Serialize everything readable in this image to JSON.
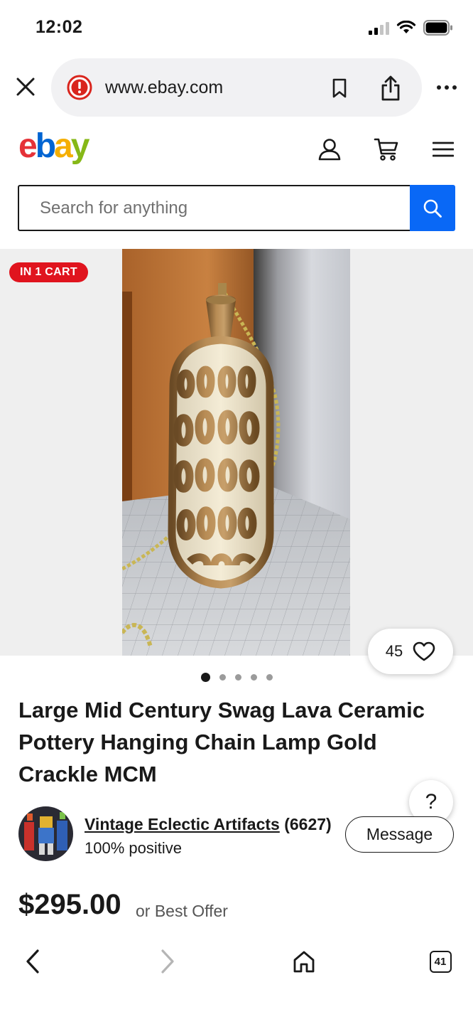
{
  "status_bar": {
    "time": "12:02"
  },
  "browser": {
    "url": "www.ebay.com"
  },
  "site": {
    "logo_letters": [
      "e",
      "b",
      "a",
      "y"
    ],
    "logo_colors": [
      "#e53238",
      "#0064d2",
      "#f5af02",
      "#86b817"
    ]
  },
  "search": {
    "placeholder": "Search for anything",
    "value": ""
  },
  "listing": {
    "cart_badge": "IN 1 CART",
    "watch_count": "45",
    "image_count": 5,
    "active_image": 1,
    "title": "Large Mid Century Swag Lava Ceramic Pottery Hanging Chain Lamp Gold Crackle MCM",
    "seller": {
      "name": "Vintage Eclectic Artifacts",
      "rating_count": "(6627)",
      "feedback": "100% positive",
      "message_label": "Message"
    },
    "price": "$295.00",
    "offer_text": "or Best Offer"
  },
  "help": {
    "label": "?"
  },
  "bottom_nav": {
    "tab_count": "41"
  },
  "colors": {
    "search_blue": "#0968f6",
    "badge_red": "#e0141e"
  }
}
